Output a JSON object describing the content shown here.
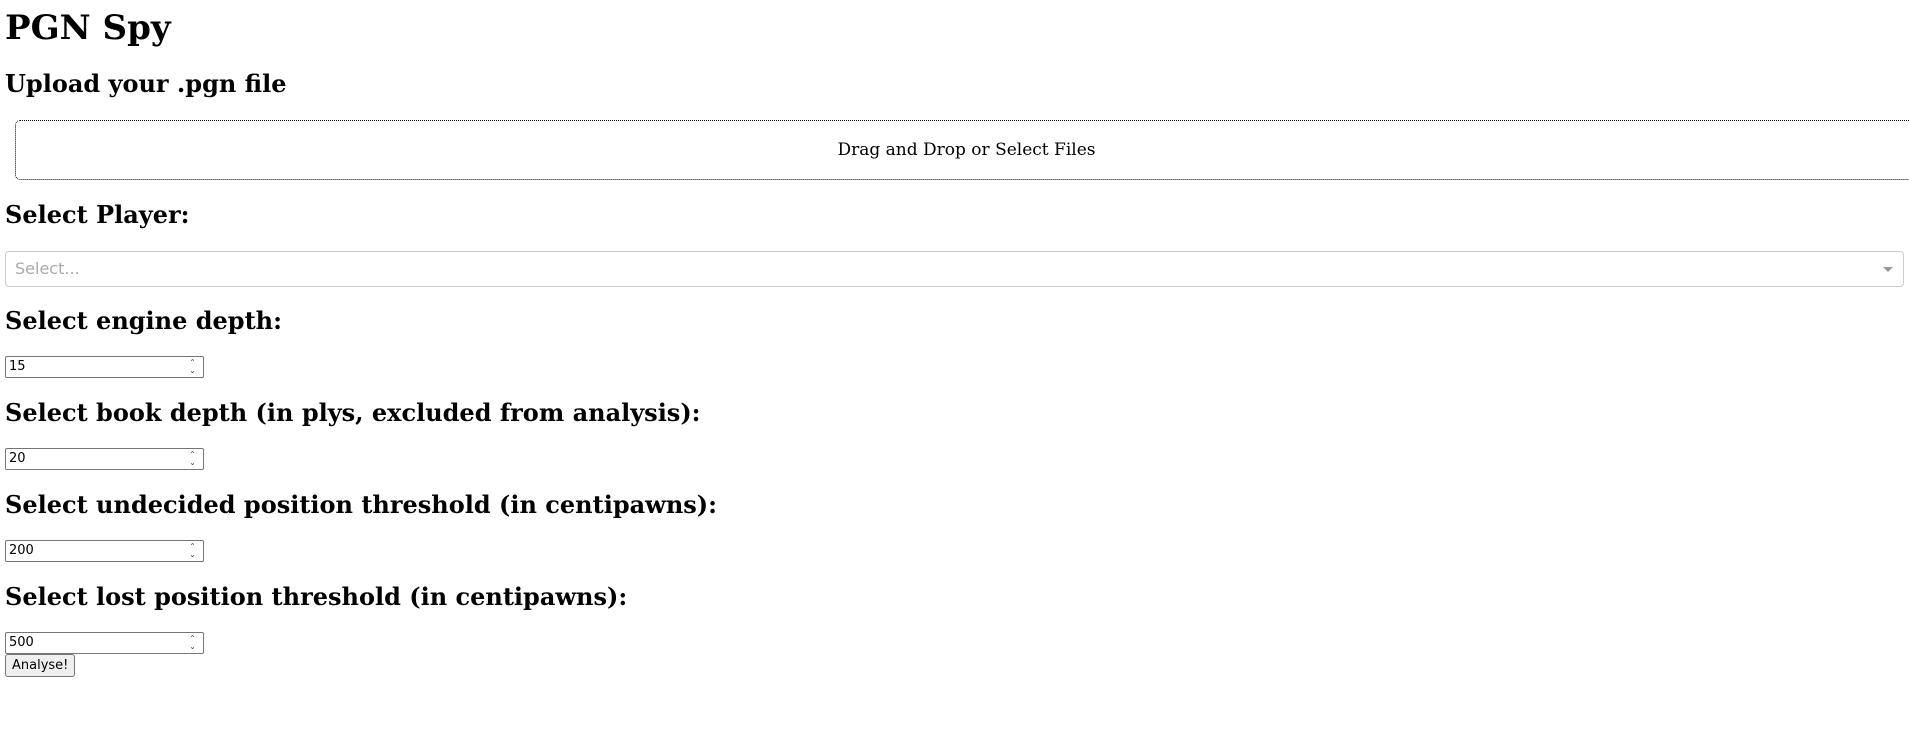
{
  "app": {
    "title": "PGN Spy"
  },
  "upload": {
    "heading": "Upload your .pgn file",
    "dropzone_text": "Drag and Drop or Select Files"
  },
  "player": {
    "heading": "Select Player:",
    "placeholder": "Select..."
  },
  "engine_depth": {
    "heading": "Select engine depth:",
    "value": "15"
  },
  "book_depth": {
    "heading": "Select book depth (in plys, excluded from analysis):",
    "value": "20"
  },
  "undecided_threshold": {
    "heading": "Select undecided position threshold (in centipawns):",
    "value": "200"
  },
  "lost_threshold": {
    "heading": "Select lost position threshold (in centipawns):",
    "value": "500"
  },
  "actions": {
    "analyse_label": "Analyse!"
  },
  "icons": {
    "select_arrow": "chevron-down-icon",
    "spinner": "spinner-arrows-icon"
  }
}
